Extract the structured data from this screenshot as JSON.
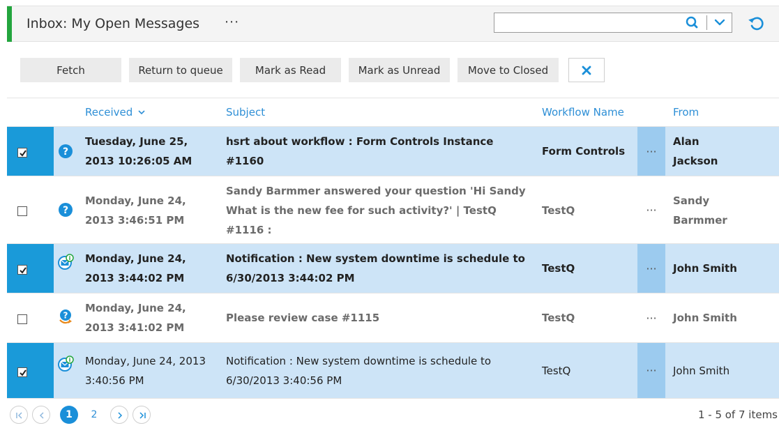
{
  "header": {
    "title": "Inbox: My Open Messages",
    "title_more": "···",
    "accent_color": "#23a53e",
    "search": {
      "value": "",
      "placeholder": ""
    },
    "icons": {
      "search": "search-icon",
      "dropdown": "chevron-down-icon",
      "refresh": "refresh-icon"
    }
  },
  "toolbar": {
    "fetch": "Fetch",
    "return_to_queue": "Return to queue",
    "mark_read": "Mark as Read",
    "mark_unread": "Mark as Unread",
    "move_closed": "Move to Closed",
    "close_icon": "close-icon"
  },
  "columns": {
    "received": "Received",
    "subject": "Subject",
    "workflow": "Workflow Name",
    "from": "From"
  },
  "rows": [
    {
      "checked": true,
      "icon": "question-icon",
      "received_1": "Tuesday, June 25,",
      "received_2": "2013 10:26:05 AM",
      "subject_1": "hsrt about workflow : Form Controls Instance",
      "subject_2": "#1160",
      "subject_3": "",
      "workflow": "Form Controls",
      "more": "···",
      "from_1": "Alan",
      "from_2": "Jackson"
    },
    {
      "checked": false,
      "icon": "question-icon",
      "received_1": "Monday, June 24,",
      "received_2": "2013 3:46:51 PM",
      "subject_1": "Sandy Barmmer answered your question 'Hi Sandy",
      "subject_2": "What is the new fee for such activity?' | TestQ",
      "subject_3": "#1116 :",
      "workflow": "TestQ",
      "more": "···",
      "from_1": "Sandy",
      "from_2": "Barmmer"
    },
    {
      "checked": true,
      "icon": "notification-icon",
      "received_1": "Monday, June 24,",
      "received_2": "2013 3:44:02 PM",
      "subject_1": "Notification : New system downtime is schedule to",
      "subject_2": "6/30/2013 3:44:02 PM",
      "subject_3": "",
      "workflow": "TestQ",
      "more": "···",
      "from_1": "John Smith",
      "from_2": ""
    },
    {
      "checked": false,
      "icon": "review-request-icon",
      "received_1": "Monday, June 24,",
      "received_2": "2013 3:41:02 PM",
      "subject_1": "Please review case #1115",
      "subject_2": "",
      "subject_3": "",
      "workflow": "TestQ",
      "more": "···",
      "from_1": "John Smith",
      "from_2": ""
    },
    {
      "checked": true,
      "icon": "notification-icon",
      "received_1": "Monday, June 24, 2013",
      "received_2": "3:40:56 PM",
      "subject_1": "Notification : New system downtime is schedule to",
      "subject_2": "6/30/2013 3:40:56 PM",
      "subject_3": "",
      "workflow": "TestQ",
      "more": "···",
      "from_1": "John Smith",
      "from_2": ""
    }
  ],
  "pager": {
    "pages": [
      "1",
      "2"
    ],
    "current_page": "1",
    "info": "1 - 5 of 7 items"
  }
}
